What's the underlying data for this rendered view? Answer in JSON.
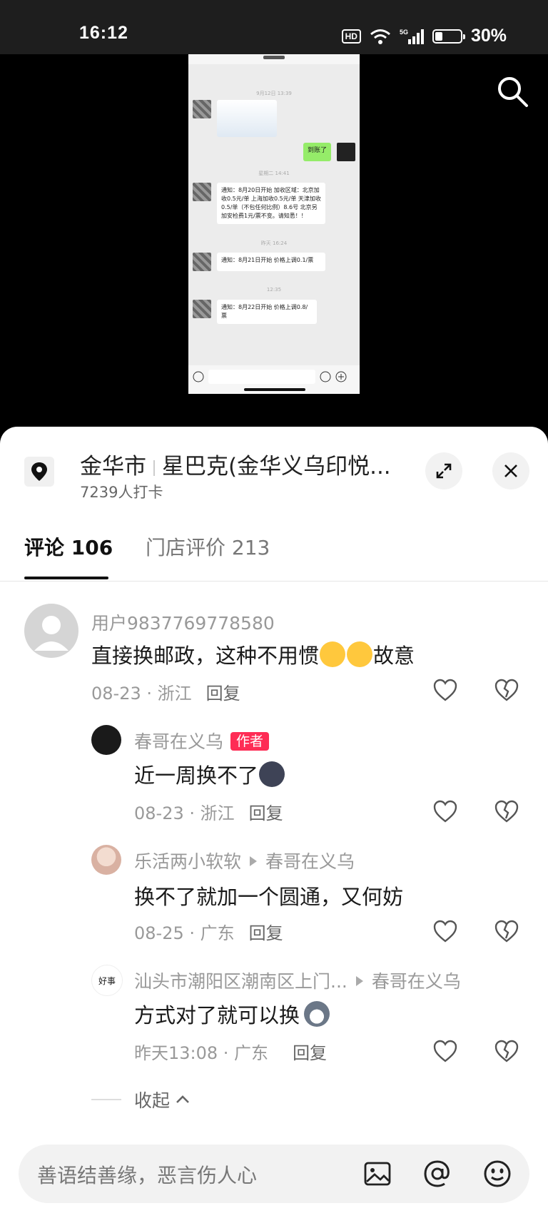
{
  "status_bar": {
    "time": "16:12",
    "hd": "HD",
    "network": "5G",
    "battery": "30%",
    "battery_level": 0.3
  },
  "video": {
    "timestamps": [
      "9月12日 13:39",
      "星期二 14:41",
      "昨天 16:24",
      "12:35"
    ],
    "sent_message": "到账了",
    "messages": [
      "通知：8月20日开始  加收区域：北京加收0.5元/单 上海加收0.5元/单 天津加收0.5/单（不包任何比例）8.6号 北京另加安检费1元/票不变。请知悉！！",
      "通知：8月21日开始  价格上调0.1/票",
      "通知：8月22日开始  价格上调0.8/票"
    ]
  },
  "location": {
    "city": "金华市",
    "place": "星巴克(金华义乌印悦...",
    "checkins": "7239人打卡"
  },
  "tabs": [
    {
      "label": "评论",
      "count": "106"
    },
    {
      "label": "门店评价",
      "count": "213"
    }
  ],
  "comments": [
    {
      "name": "用户9837769778580",
      "text_before": "直接换邮政，这种不用惯",
      "text_after": "故意",
      "date": "08-23 · 浙江",
      "reply": "回复"
    },
    {
      "name": "春哥在义乌",
      "badge": "作者",
      "text": "近一周换不了",
      "date": "08-23 · 浙江",
      "reply": "回复"
    },
    {
      "name": "乐活两小软软",
      "reply_to": "春哥在义乌",
      "text": "换不了就加一个圆通，又何妨",
      "date": "08-25 · 广东",
      "reply": "回复"
    },
    {
      "name": "汕头市潮阳区潮南区上门...",
      "reply_to": "春哥在义乌",
      "text": "方式对了就可以换",
      "date": "昨天13:08 · 广东",
      "reply": "回复",
      "avatar_text": "好事"
    }
  ],
  "collapse_label": "收起",
  "input": {
    "placeholder": "善语结善缘，恶言伤人心"
  }
}
